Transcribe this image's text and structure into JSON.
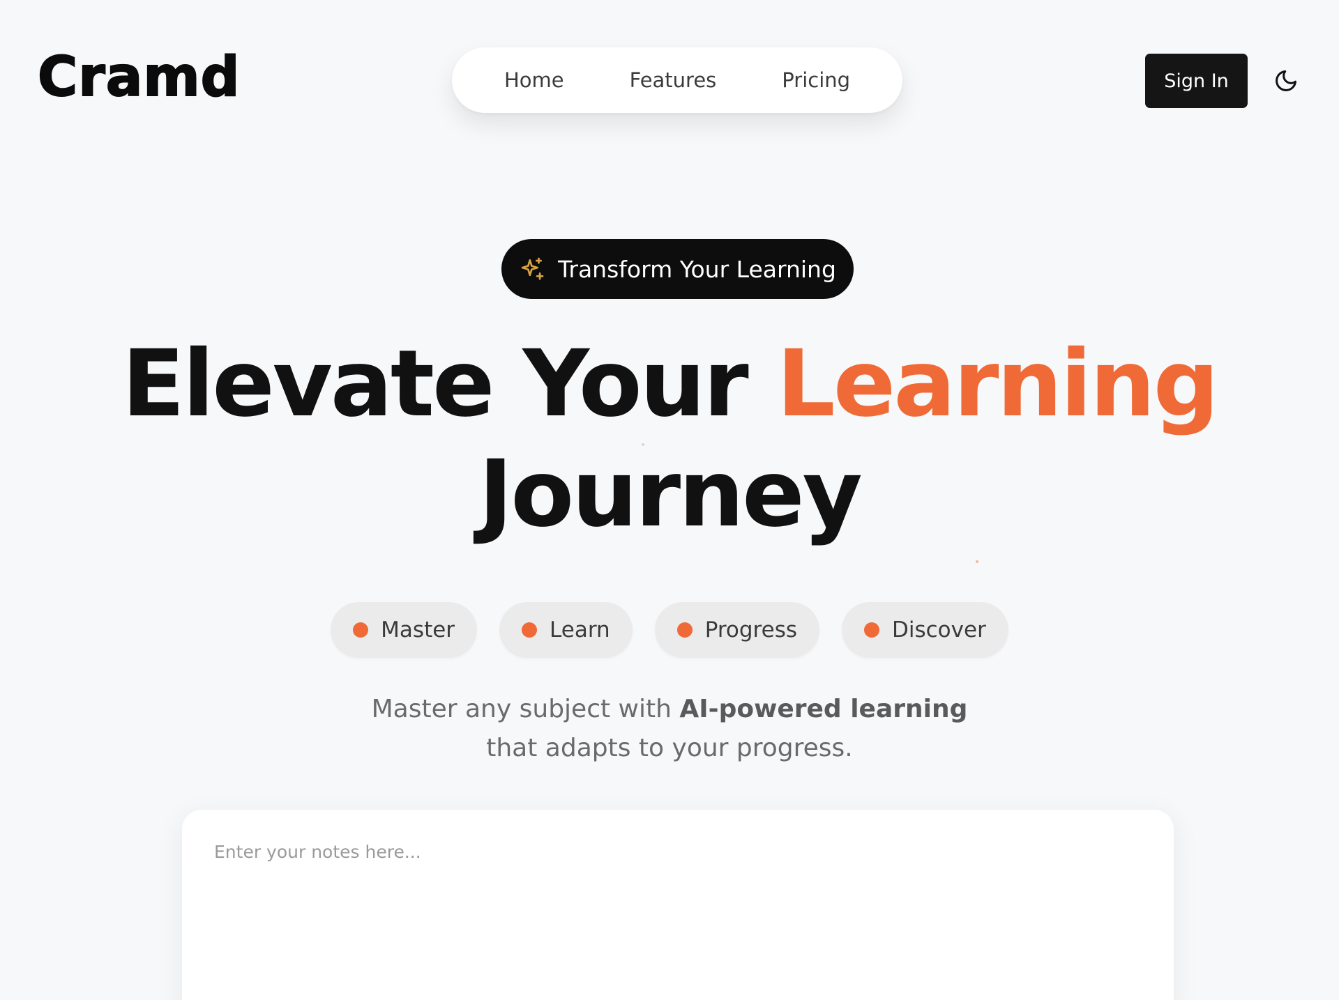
{
  "header": {
    "logo": "Cramd",
    "nav": [
      {
        "label": "Home"
      },
      {
        "label": "Features"
      },
      {
        "label": "Pricing"
      }
    ],
    "sign_in_label": "Sign In",
    "theme_toggle_icon": "moon-icon"
  },
  "hero": {
    "badge_icon": "sparkles-icon",
    "badge_text": "Transform Your Learning",
    "title_part1": "Elevate Your ",
    "title_accent": "Learning",
    "title_part2": "Journey",
    "chips": [
      {
        "label": "Master"
      },
      {
        "label": "Learn"
      },
      {
        "label": "Progress"
      },
      {
        "label": "Discover"
      }
    ],
    "description_prefix": "Master any subject with ",
    "description_bold": "AI-powered learning",
    "description_suffix": "that adapts to your progress."
  },
  "notes": {
    "placeholder": "Enter your notes here...",
    "value": ""
  },
  "colors": {
    "accent": "#ef6a36",
    "dark": "#111111",
    "background": "#f7f8fa",
    "chip_bg": "#ebebec",
    "badge_icon": "#d9a441"
  }
}
